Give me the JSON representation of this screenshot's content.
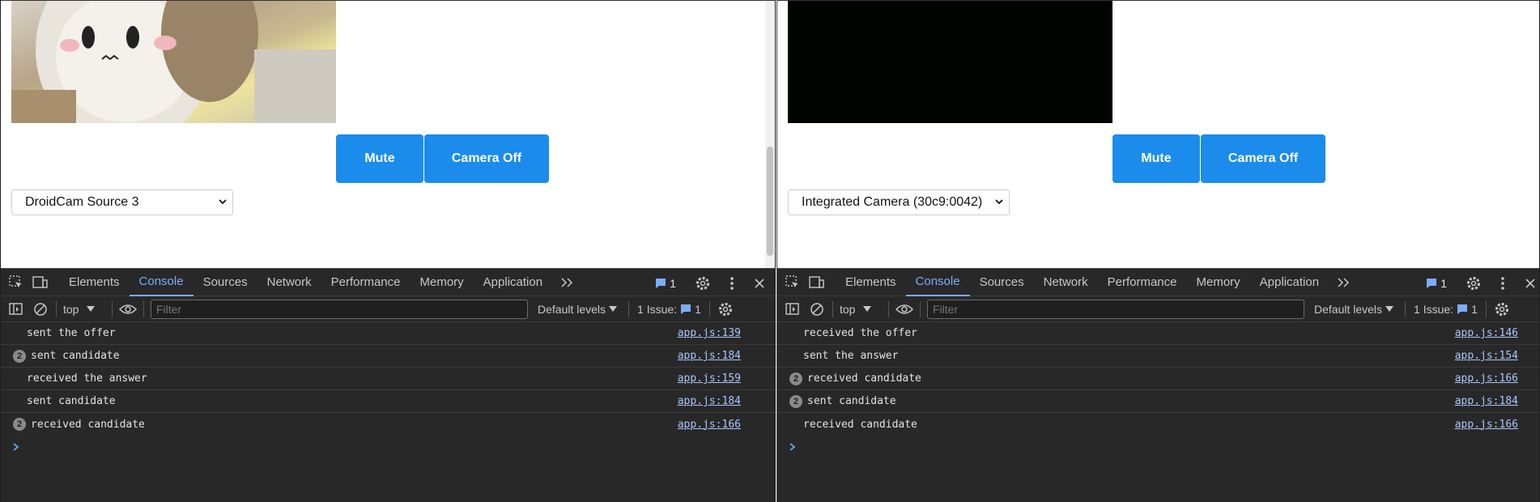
{
  "left": {
    "buttons": {
      "mute": "Mute",
      "camera_off": "Camera Off"
    },
    "camera_select": "DroidCam Source 3",
    "devtools": {
      "tabs": [
        "Elements",
        "Console",
        "Sources",
        "Network",
        "Performance",
        "Memory",
        "Application"
      ],
      "active_tab": "Console",
      "message_badge": "1",
      "context": "top",
      "filter_placeholder": "Filter",
      "levels": "Default levels",
      "issues_label": "1 Issue:",
      "issues_count": "1",
      "logs": [
        {
          "count": "",
          "message": "sent the offer",
          "source": "app.js:139"
        },
        {
          "count": "2",
          "message": "sent candidate",
          "source": "app.js:184"
        },
        {
          "count": "",
          "message": "received the answer",
          "source": "app.js:159"
        },
        {
          "count": "",
          "message": "sent candidate",
          "source": "app.js:184"
        },
        {
          "count": "2",
          "message": "received candidate",
          "source": "app.js:166"
        }
      ]
    }
  },
  "right": {
    "buttons": {
      "mute": "Mute",
      "camera_off": "Camera Off"
    },
    "camera_select": "Integrated Camera (30c9:0042)",
    "devtools": {
      "tabs": [
        "Elements",
        "Console",
        "Sources",
        "Network",
        "Performance",
        "Memory",
        "Application"
      ],
      "active_tab": "Console",
      "message_badge": "1",
      "context": "top",
      "filter_placeholder": "Filter",
      "levels": "Default levels",
      "issues_label": "1 Issue:",
      "issues_count": "1",
      "logs": [
        {
          "count": "",
          "message": "received the offer",
          "source": "app.js:146"
        },
        {
          "count": "",
          "message": "sent the answer",
          "source": "app.js:154"
        },
        {
          "count": "2",
          "message": "received candidate",
          "source": "app.js:166"
        },
        {
          "count": "2",
          "message": "sent candidate",
          "source": "app.js:184"
        },
        {
          "count": "",
          "message": "received candidate",
          "source": "app.js:166"
        }
      ]
    }
  },
  "colors": {
    "button_blue": "#1b8ceb",
    "devtools_bg": "#282828",
    "link": "#a8c7fa",
    "active_tab": "#7cacf8"
  }
}
